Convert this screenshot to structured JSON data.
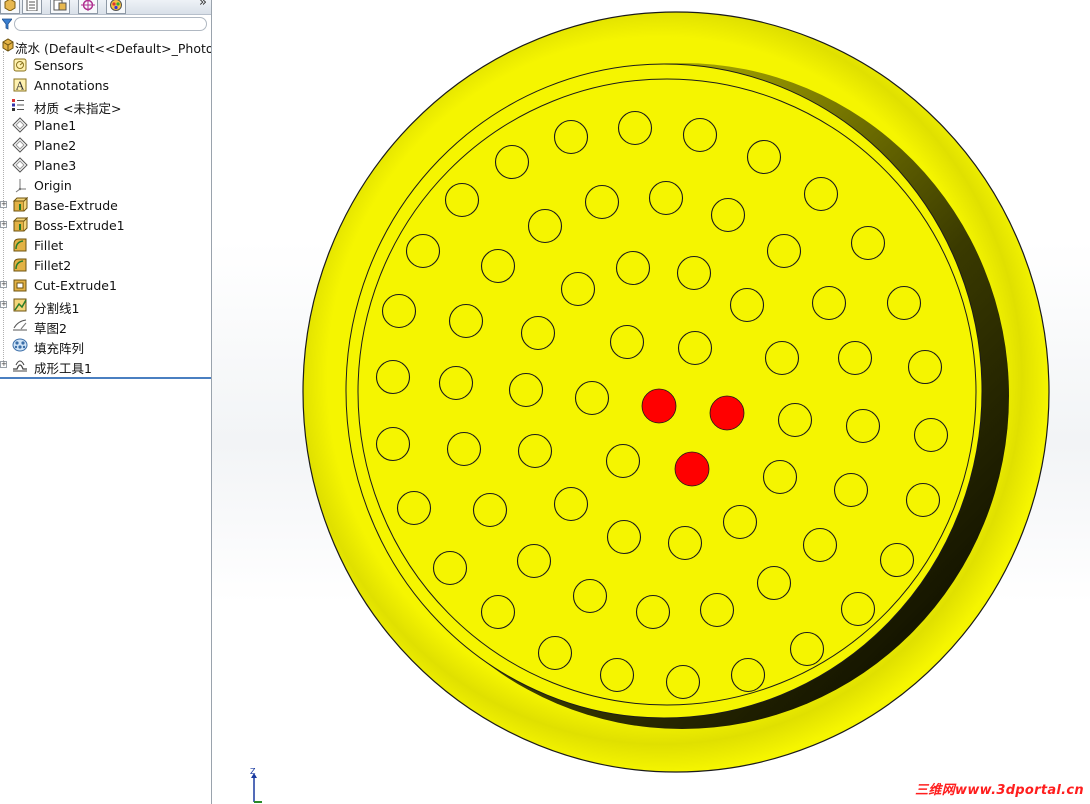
{
  "tabs": [
    {
      "icon": "feature-manager-icon"
    },
    {
      "icon": "property-manager-icon"
    },
    {
      "icon": "configuration-manager-icon"
    },
    {
      "icon": "dimxpert-icon"
    },
    {
      "icon": "display-manager-icon"
    }
  ],
  "tab_more": "»",
  "tree": {
    "root": {
      "label": "流水  (Default<<Default>_PhotoW",
      "icon": "part-icon"
    },
    "items": [
      {
        "label": "Sensors",
        "icon": "sensors-icon",
        "expandable": false
      },
      {
        "label": "Annotations",
        "icon": "annotations-icon",
        "expandable": false
      },
      {
        "label": "材质 <未指定>",
        "icon": "material-icon",
        "expandable": false
      },
      {
        "label": "Plane1",
        "icon": "plane-icon",
        "expandable": false
      },
      {
        "label": "Plane2",
        "icon": "plane-icon",
        "expandable": false
      },
      {
        "label": "Plane3",
        "icon": "plane-icon",
        "expandable": false
      },
      {
        "label": "Origin",
        "icon": "origin-icon",
        "expandable": false
      },
      {
        "label": "Base-Extrude",
        "icon": "extrude-icon",
        "expandable": true
      },
      {
        "label": "Boss-Extrude1",
        "icon": "extrude-icon",
        "expandable": true
      },
      {
        "label": "Fillet",
        "icon": "fillet-icon",
        "expandable": false
      },
      {
        "label": "Fillet2",
        "icon": "fillet-icon",
        "expandable": false
      },
      {
        "label": "Cut-Extrude1",
        "icon": "cut-extrude-icon",
        "expandable": true
      },
      {
        "label": "分割线1",
        "icon": "split-line-icon",
        "expandable": true
      },
      {
        "label": "草图2",
        "icon": "sketch-icon",
        "expandable": false
      },
      {
        "label": "填充阵列",
        "icon": "fill-pattern-icon",
        "expandable": false
      },
      {
        "label": "成形工具1",
        "icon": "forming-tool-icon",
        "expandable": true
      }
    ]
  },
  "model": {
    "part_color": "#f5f500",
    "red_holes_color": "#ff0000",
    "outline_color": "#1a1a1a"
  },
  "triad": {
    "axis_label": "Z"
  },
  "watermark": "三维网www.3dportal.cn"
}
